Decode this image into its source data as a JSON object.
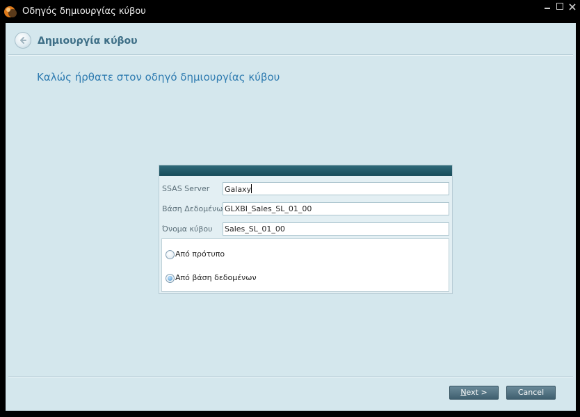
{
  "window": {
    "title": "Οδηγός δημιουργίας κύβου",
    "controls": {
      "minimize": "minimize-icon",
      "maximize": "maximize-icon",
      "close": "close-icon"
    }
  },
  "header": {
    "back_icon": "back-arrow-icon",
    "title": "Δημιουργία κύβου"
  },
  "welcome_text": "Καλώς ήρθατε στον οδηγό δημιουργίας κύβου",
  "form": {
    "fields": [
      {
        "label": "SSAS Server",
        "value": "Galaxy"
      },
      {
        "label": "Βάση Δεδομένων",
        "value": "GLXBI_Sales_SL_01_00"
      },
      {
        "label": "Όνομα κύβου",
        "value": "Sales_SL_01_00"
      }
    ],
    "options": [
      {
        "label": "Από πρότυπο",
        "selected": false
      },
      {
        "label": "Από βάση δεδομένων",
        "selected": true
      }
    ]
  },
  "buttons": {
    "next_mnemonic": "N",
    "next_rest": "ext >",
    "cancel": "Cancel"
  },
  "colors": {
    "background": "#d4e7ed",
    "accent_text": "#2e7bb0",
    "header_text": "#3d6e86",
    "panel_header": "#184c5a",
    "button": "#4f6f7f"
  }
}
